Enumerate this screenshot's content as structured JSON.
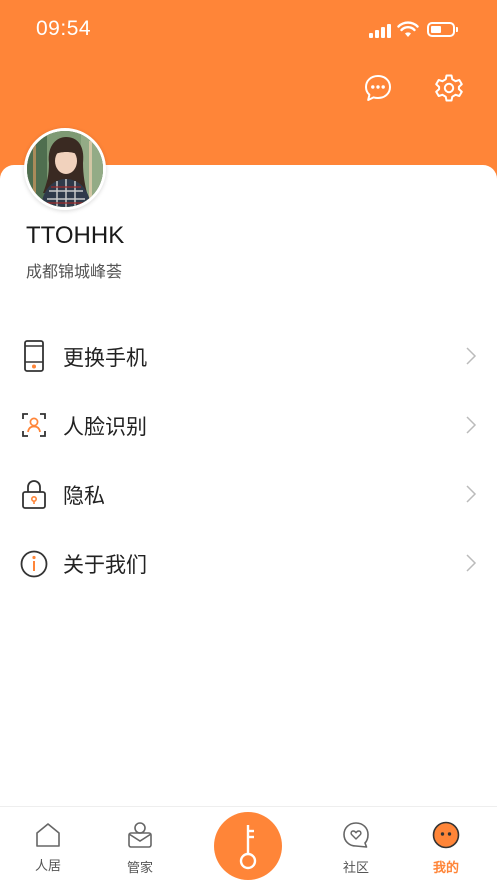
{
  "status_bar": {
    "time": "09:54"
  },
  "profile": {
    "username": "TTOHHK",
    "community": "成都锦城峰荟"
  },
  "header_actions": {
    "message_icon": "chat-bubble-icon",
    "settings_icon": "gear-icon"
  },
  "menu": {
    "items": [
      {
        "label": "更换手机",
        "icon": "phone-icon"
      },
      {
        "label": "人脸识别",
        "icon": "face-scan-icon"
      },
      {
        "label": "隐私",
        "icon": "lock-icon"
      },
      {
        "label": "关于我们",
        "icon": "info-icon"
      }
    ]
  },
  "tabbar": {
    "tabs": [
      {
        "label": "人居",
        "icon": "home-icon"
      },
      {
        "label": "管家",
        "icon": "butler-icon"
      },
      {
        "label": "",
        "icon": "key-icon"
      },
      {
        "label": "社区",
        "icon": "heart-chat-icon"
      },
      {
        "label": "我的",
        "icon": "profile-face-icon",
        "active": true
      }
    ]
  },
  "colors": {
    "accent": "#FF8538",
    "background": "#FFFFFF",
    "text": "#222222"
  }
}
